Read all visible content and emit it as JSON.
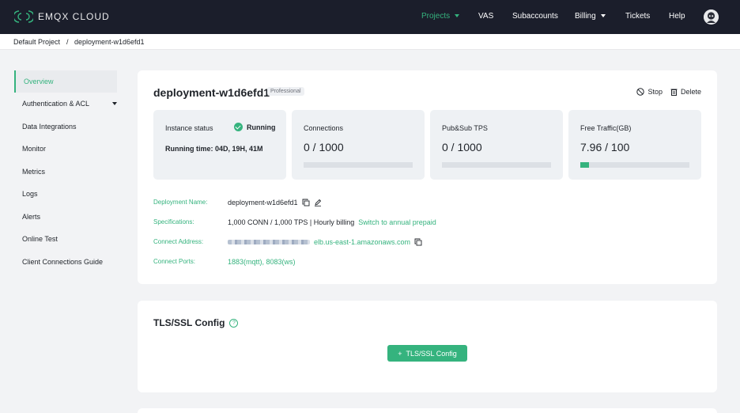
{
  "brand": {
    "name": "EMQX CLOUD",
    "accent": "#35b37e",
    "nav_bg": "#1b1e2b"
  },
  "nav": {
    "items": [
      {
        "label": "Projects"
      },
      {
        "label": "VAS"
      },
      {
        "label": "Subaccounts"
      },
      {
        "label": "Billing"
      },
      {
        "label": "Tickets"
      },
      {
        "label": "Help"
      }
    ]
  },
  "breadcrumb": {
    "project": "Default Project",
    "separator": "/",
    "deployment": "deployment-w1d6efd1"
  },
  "sidebar": {
    "items": [
      {
        "label": "Overview"
      },
      {
        "label": "Authentication & ACL"
      },
      {
        "label": "Data Integrations"
      },
      {
        "label": "Monitor"
      },
      {
        "label": "Metrics"
      },
      {
        "label": "Logs"
      },
      {
        "label": "Alerts"
      },
      {
        "label": "Online Test"
      },
      {
        "label": "Client Connections Guide"
      }
    ]
  },
  "deployment": {
    "name": "deployment-w1d6efd1",
    "badge": "Professional",
    "actions": {
      "stop": "Stop",
      "delete": "Delete"
    }
  },
  "stats": {
    "instance": {
      "label": "Instance status",
      "status": "Running",
      "running_time": "Running time: 04D, 19H, 41M"
    },
    "connections": {
      "label": "Connections",
      "value": "0 / 1000",
      "progress": 0
    },
    "pubsub": {
      "label": "Pub&Sub TPS",
      "value": "0 / 1000",
      "progress": 0
    },
    "traffic": {
      "label": "Free Traffic(GB)",
      "value": "7.96 / 100",
      "progress": 0.08
    }
  },
  "info": {
    "name_label": "Deployment Name:",
    "name_value": "deployment-w1d6efd1",
    "spec_label": "Specifications:",
    "spec_value": "1,000 CONN / 1,000 TPS | Hourly billing",
    "spec_link": "Switch to annual prepaid",
    "addr_label": "Connect Address:",
    "addr_value": "elb.us-east-1.amazonaws.com",
    "ports_label": "Connect Ports:",
    "ports_value": "1883(mqtt), 8083(ws)"
  },
  "tls": {
    "title": "TLS/SSL Config",
    "button": "TLS/SSL Config",
    "button_plus": "+"
  }
}
